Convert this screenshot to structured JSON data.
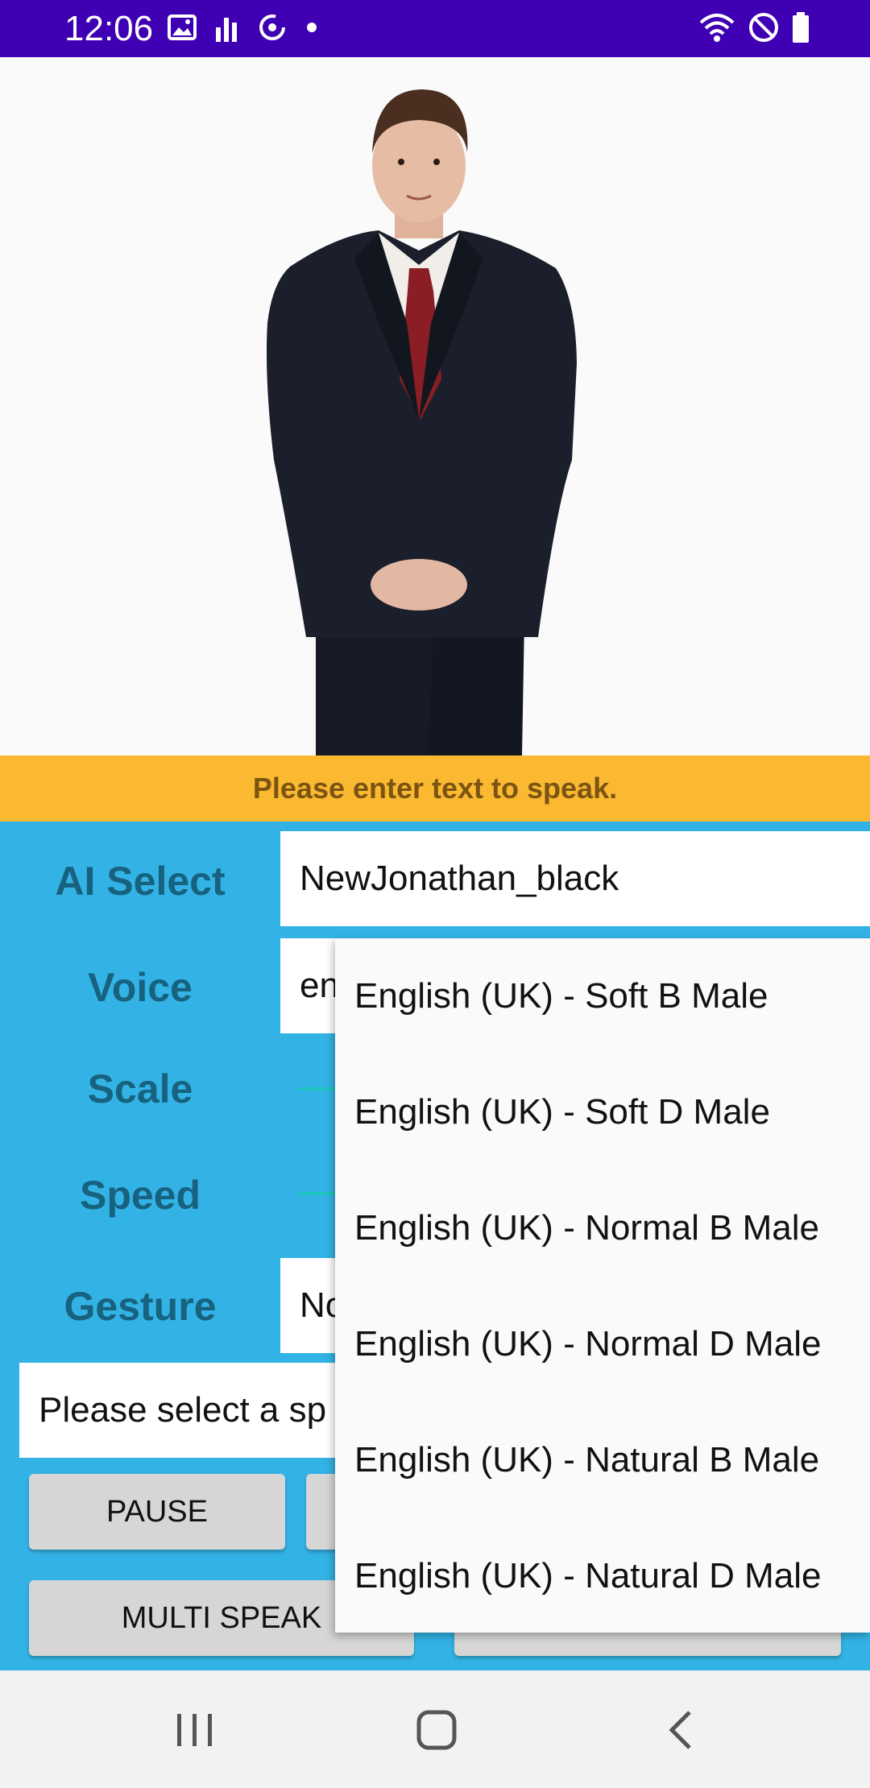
{
  "status_bar": {
    "time": "12:06",
    "left_icons": [
      "image-icon",
      "signal-bars-icon",
      "sync-icon",
      "dot-icon"
    ],
    "right_icons": [
      "wifi-icon",
      "do-not-disturb-icon",
      "battery-icon"
    ]
  },
  "banner": {
    "message": "Please enter text to speak."
  },
  "controls": {
    "ai_select_label": "AI Select",
    "ai_select_value": "NewJonathan_black",
    "voice_label": "Voice",
    "voice_value_partial": "en",
    "scale_label": "Scale",
    "speed_label": "Speed",
    "gesture_label": "Gesture",
    "gesture_value_partial": "No",
    "speak_input_placeholder_partial": "Please select a sp"
  },
  "buttons": {
    "pause": "PAUSE",
    "multi_speak": "MULTI SPEAK"
  },
  "voice_dropdown": {
    "options": [
      "English (UK) - Soft B Male",
      "English (UK) - Soft D Male",
      "English (UK) - Normal B Male",
      "English (UK) - Normal D Male",
      "English (UK) - Natural B Male",
      "English (UK) - Natural D Male"
    ]
  },
  "nav_bar": {
    "icons": [
      "recent-apps-icon",
      "home-icon",
      "back-icon"
    ]
  },
  "colors": {
    "status_bar": "#3f00b4",
    "banner": "#fbb932",
    "panel": "#33b3e5",
    "label_text": "#17627f"
  }
}
